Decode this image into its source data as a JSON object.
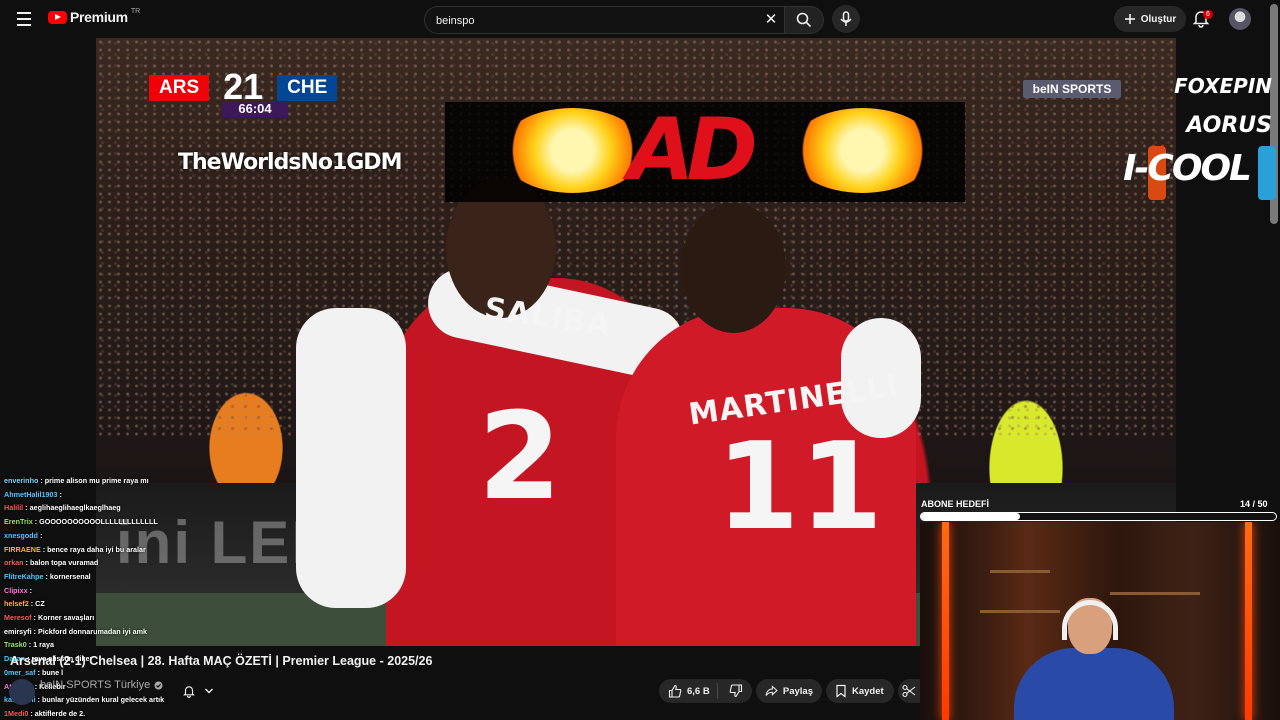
{
  "header": {
    "menu_icon": "hamburger-menu-icon",
    "logo_text": "Premium",
    "logo_cc": "TR",
    "search_value": "beinspo",
    "create_label": "Oluştur",
    "notification_count": "6"
  },
  "overlay": {
    "score": {
      "home": "ARS",
      "home_goals": "2",
      "away_goals": "1",
      "away": "CHE",
      "time": "66:04",
      "home_color": "#ef0107",
      "away_color": "#034694"
    },
    "worlds": "TheWorldsNo1GDM",
    "ad_logo": "AD",
    "broadcaster": "beIN SPORTS",
    "sponsors": [
      "FOXEPIN",
      "AORUS",
      "I-COOL"
    ],
    "subtitle_goal_label": "ABONE HEDEFİ",
    "subtitle_goal_count": "14  / 50",
    "subtitle_goal_progress": 0.28,
    "video_text": {
      "player1_name": "SALIBA",
      "player1_number": "2",
      "player2_name": "MARTINELLI",
      "player2_number": "11",
      "board": "ini LED"
    }
  },
  "chat": [
    {
      "user": "enverinho",
      "msg": ": prime alison mu prime raya mı",
      "color": "#7fd3ff"
    },
    {
      "user": "AhmetHalil1903",
      "msg": ":",
      "color": "#55c7ff"
    },
    {
      "user": "Halilil",
      "msg": ": aeglihaeglihaeglkaeglhaeg",
      "color": "#ff5a5a"
    },
    {
      "user": "ErenTrix",
      "msg": ": GOOOOOOOOOOLLLLLLLLLLLLL",
      "color": "#9be36b"
    },
    {
      "user": "xnesgodd",
      "msg": ":",
      "color": "#55c7ff"
    },
    {
      "user": "FIRRAENE",
      "msg": ": bence raya daha iyi bu aralar",
      "color": "#ffb347"
    },
    {
      "user": "orkan",
      "msg": ": balon topa vuramad",
      "color": "#ff5a5a"
    },
    {
      "user": "FlitreKahpe",
      "msg": ": kornersenal",
      "color": "#55c7ff"
    },
    {
      "user": "Clipixx",
      "msg": ":",
      "color": "#ff7ad9"
    },
    {
      "user": "helsef2",
      "msg": ": CZ",
      "color": "#ffb347"
    },
    {
      "user": "Meresof",
      "msg": ": Korner savaşları",
      "color": "#ff5a5a"
    },
    {
      "user": "emirsyfi",
      "msg": ": Pickford donnarumadan iyi amk",
      "color": "#ffffff"
    },
    {
      "user": "Trask0",
      "msg": ": 1 raya",
      "color": "#9be36b"
    },
    {
      "user": "Dazan",
      "msg": ": raya alisson diker",
      "color": "#55c7ff"
    },
    {
      "user": "0mer_saf",
      "msg": ": bune l",
      "color": "#55c7ff"
    },
    {
      "user": "AtROND",
      "msg": ": Kellebir",
      "color": "#ff7ad9"
    },
    {
      "user": "kalerpeni",
      "msg": ": bunlar yüzünden kural gelecek artık",
      "color": "#55c7ff"
    },
    {
      "user": "1Medi0",
      "msg": ": aktiflerde de 2.",
      "color": "#ff5a5a"
    }
  ],
  "video": {
    "title": "Arsenal (2-1) Chelsea | 28. Hafta MAÇ ÖZETİ | Premier League - 2025/26",
    "channel": "beIN SPORTS Türkiye",
    "likes": "6,6 B",
    "share_label": "Paylaş",
    "save_label": "Kaydet"
  }
}
